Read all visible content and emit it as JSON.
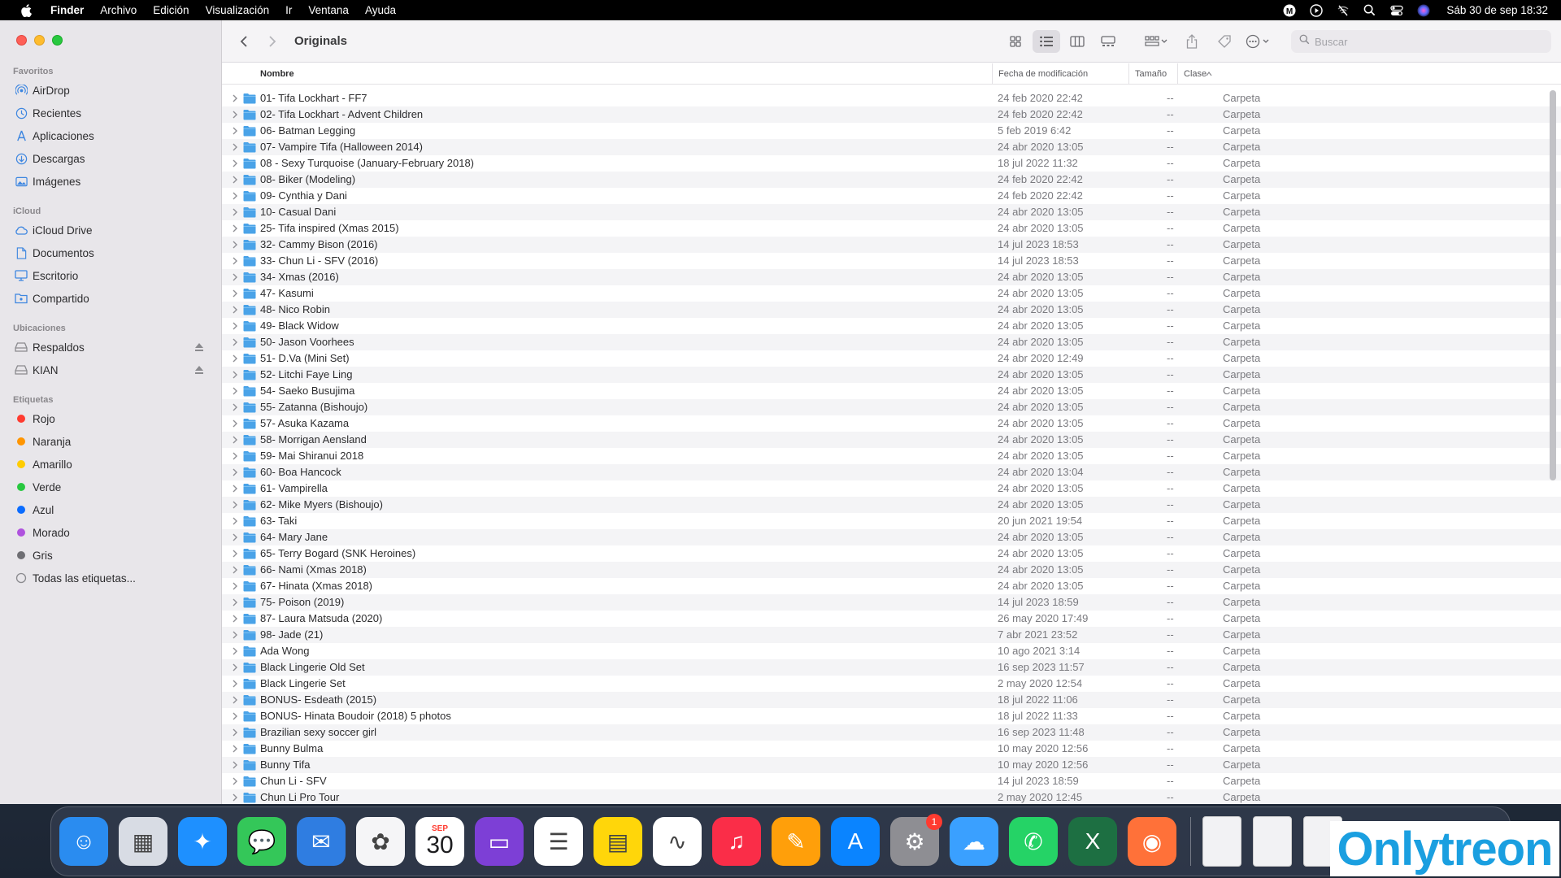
{
  "menubar": {
    "app_name": "Finder",
    "menus": [
      "Archivo",
      "Edición",
      "Visualización",
      "Ir",
      "Ventana",
      "Ayuda"
    ],
    "clock": "Sáb 30 de sep  18:32",
    "status_icons": [
      "m-icon",
      "play-icon",
      "wifi-off-icon",
      "search-icon",
      "control-center-icon",
      "siri-icon"
    ]
  },
  "window": {
    "title": "Originals",
    "search_placeholder": "Buscar"
  },
  "sidebar": {
    "sections": [
      {
        "title": "Favoritos",
        "items": [
          {
            "label": "AirDrop",
            "icon": "airdrop-icon"
          },
          {
            "label": "Recientes",
            "icon": "clock-icon"
          },
          {
            "label": "Aplicaciones",
            "icon": "apps-icon"
          },
          {
            "label": "Descargas",
            "icon": "download-icon"
          },
          {
            "label": "Imágenes",
            "icon": "photo-icon"
          }
        ]
      },
      {
        "title": "iCloud",
        "items": [
          {
            "label": "iCloud Drive",
            "icon": "cloud-icon"
          },
          {
            "label": "Documentos",
            "icon": "document-icon"
          },
          {
            "label": "Escritorio",
            "icon": "desktop-icon"
          },
          {
            "label": "Compartido",
            "icon": "shared-folder-icon"
          }
        ]
      },
      {
        "title": "Ubicaciones",
        "items": [
          {
            "label": "Respaldos",
            "icon": "drive-icon",
            "eject": true
          },
          {
            "label": "KIAN",
            "icon": "drive-icon",
            "eject": true
          }
        ]
      },
      {
        "title": "Etiquetas",
        "items": [
          {
            "label": "Rojo",
            "tag_color": "#ff3b30"
          },
          {
            "label": "Naranja",
            "tag_color": "#ff9500"
          },
          {
            "label": "Amarillo",
            "tag_color": "#ffcc00"
          },
          {
            "label": "Verde",
            "tag_color": "#28c840"
          },
          {
            "label": "Azul",
            "tag_color": "#0a6cff"
          },
          {
            "label": "Morado",
            "tag_color": "#af52de"
          },
          {
            "label": "Gris",
            "tag_color": "#6e6e73"
          },
          {
            "label": "Todas las etiquetas...",
            "icon": "tags-icon"
          }
        ]
      }
    ]
  },
  "columns": {
    "name": "Nombre",
    "date": "Fecha de modificación",
    "size": "Tamaño",
    "kind": "Clase"
  },
  "files": [
    {
      "name": "01- Tifa Lockhart - FF7",
      "date": "24 feb 2020 22:42",
      "size": "--",
      "kind": "Carpeta"
    },
    {
      "name": "02- Tifa Lockhart - Advent Children",
      "date": "24 feb 2020 22:42",
      "size": "--",
      "kind": "Carpeta"
    },
    {
      "name": "06- Batman Legging",
      "date": "5 feb 2019 6:42",
      "size": "--",
      "kind": "Carpeta"
    },
    {
      "name": "07- Vampire Tifa (Halloween 2014)",
      "date": "24 abr 2020 13:05",
      "size": "--",
      "kind": "Carpeta"
    },
    {
      "name": "08 - Sexy Turquoise (January-February 2018)",
      "date": "18 jul 2022 11:32",
      "size": "--",
      "kind": "Carpeta"
    },
    {
      "name": "08- Biker (Modeling)",
      "date": "24 feb 2020 22:42",
      "size": "--",
      "kind": "Carpeta"
    },
    {
      "name": "09- Cynthia y Dani",
      "date": "24 feb 2020 22:42",
      "size": "--",
      "kind": "Carpeta"
    },
    {
      "name": "10- Casual Dani",
      "date": "24 abr 2020 13:05",
      "size": "--",
      "kind": "Carpeta"
    },
    {
      "name": "25- Tifa inspired (Xmas 2015)",
      "date": "24 abr 2020 13:05",
      "size": "--",
      "kind": "Carpeta"
    },
    {
      "name": "32- Cammy Bison (2016)",
      "date": "14 jul 2023 18:53",
      "size": "--",
      "kind": "Carpeta"
    },
    {
      "name": "33- Chun Li - SFV (2016)",
      "date": "14 jul 2023 18:53",
      "size": "--",
      "kind": "Carpeta"
    },
    {
      "name": "34- Xmas (2016)",
      "date": "24 abr 2020 13:05",
      "size": "--",
      "kind": "Carpeta"
    },
    {
      "name": "47- Kasumi",
      "date": "24 abr 2020 13:05",
      "size": "--",
      "kind": "Carpeta"
    },
    {
      "name": "48- Nico Robin",
      "date": "24 abr 2020 13:05",
      "size": "--",
      "kind": "Carpeta"
    },
    {
      "name": "49- Black Widow",
      "date": "24 abr 2020 13:05",
      "size": "--",
      "kind": "Carpeta"
    },
    {
      "name": "50- Jason Voorhees",
      "date": "24 abr 2020 13:05",
      "size": "--",
      "kind": "Carpeta"
    },
    {
      "name": "51- D.Va (Mini Set)",
      "date": "24 abr 2020 12:49",
      "size": "--",
      "kind": "Carpeta"
    },
    {
      "name": "52- Litchi Faye Ling",
      "date": "24 abr 2020 13:05",
      "size": "--",
      "kind": "Carpeta"
    },
    {
      "name": "54- Saeko Busujima",
      "date": "24 abr 2020 13:05",
      "size": "--",
      "kind": "Carpeta"
    },
    {
      "name": "55- Zatanna (Bishoujo)",
      "date": "24 abr 2020 13:05",
      "size": "--",
      "kind": "Carpeta"
    },
    {
      "name": "57- Asuka Kazama",
      "date": "24 abr 2020 13:05",
      "size": "--",
      "kind": "Carpeta"
    },
    {
      "name": "58- Morrigan Aensland",
      "date": "24 abr 2020 13:05",
      "size": "--",
      "kind": "Carpeta"
    },
    {
      "name": "59- Mai Shiranui 2018",
      "date": "24 abr 2020 13:05",
      "size": "--",
      "kind": "Carpeta"
    },
    {
      "name": "60- Boa Hancock",
      "date": "24 abr 2020 13:04",
      "size": "--",
      "kind": "Carpeta"
    },
    {
      "name": "61- Vampirella",
      "date": "24 abr 2020 13:05",
      "size": "--",
      "kind": "Carpeta"
    },
    {
      "name": "62- Mike Myers (Bishoujo)",
      "date": "24 abr 2020 13:05",
      "size": "--",
      "kind": "Carpeta"
    },
    {
      "name": "63- Taki",
      "date": "20 jun 2021 19:54",
      "size": "--",
      "kind": "Carpeta"
    },
    {
      "name": "64- Mary Jane",
      "date": "24 abr 2020 13:05",
      "size": "--",
      "kind": "Carpeta"
    },
    {
      "name": "65- Terry Bogard (SNK Heroines)",
      "date": "24 abr 2020 13:05",
      "size": "--",
      "kind": "Carpeta"
    },
    {
      "name": "66- Nami (Xmas 2018)",
      "date": "24 abr 2020 13:05",
      "size": "--",
      "kind": "Carpeta"
    },
    {
      "name": "67- Hinata (Xmas 2018)",
      "date": "24 abr 2020 13:05",
      "size": "--",
      "kind": "Carpeta"
    },
    {
      "name": "75- Poison (2019)",
      "date": "14 jul 2023 18:59",
      "size": "--",
      "kind": "Carpeta"
    },
    {
      "name": "87- Laura Matsuda (2020)",
      "date": "26 may 2020 17:49",
      "size": "--",
      "kind": "Carpeta"
    },
    {
      "name": "98- Jade (21)",
      "date": "7 abr 2021 23:52",
      "size": "--",
      "kind": "Carpeta"
    },
    {
      "name": "Ada Wong",
      "date": "10 ago 2021 3:14",
      "size": "--",
      "kind": "Carpeta"
    },
    {
      "name": "Black Lingerie Old Set",
      "date": "16 sep 2023 11:57",
      "size": "--",
      "kind": "Carpeta"
    },
    {
      "name": "Black Lingerie Set",
      "date": "2 may 2020 12:54",
      "size": "--",
      "kind": "Carpeta"
    },
    {
      "name": "BONUS- Esdeath (2015)",
      "date": "18 jul 2022 11:06",
      "size": "--",
      "kind": "Carpeta"
    },
    {
      "name": "BONUS- Hinata Boudoir (2018) 5 photos",
      "date": "18 jul 2022 11:33",
      "size": "--",
      "kind": "Carpeta"
    },
    {
      "name": "Brazilian sexy soccer girl",
      "date": "16 sep 2023 11:48",
      "size": "--",
      "kind": "Carpeta"
    },
    {
      "name": "Bunny Bulma",
      "date": "10 may 2020 12:56",
      "size": "--",
      "kind": "Carpeta"
    },
    {
      "name": "Bunny Tifa",
      "date": "10 may 2020 12:56",
      "size": "--",
      "kind": "Carpeta"
    },
    {
      "name": "Chun Li - SFV",
      "date": "14 jul 2023 18:59",
      "size": "--",
      "kind": "Carpeta"
    },
    {
      "name": "Chun Li Pro Tour",
      "date": "2 may 2020 12:45",
      "size": "--",
      "kind": "Carpeta"
    }
  ],
  "dock": {
    "apps": [
      {
        "name": "finder-icon",
        "color": "#2a8cf0",
        "glyph": "☺"
      },
      {
        "name": "launchpad-icon",
        "color": "#d8dce4",
        "glyph": "▦"
      },
      {
        "name": "safari-icon",
        "color": "#1e90ff",
        "glyph": "✦"
      },
      {
        "name": "messages-icon",
        "color": "#34c759",
        "glyph": "💬"
      },
      {
        "name": "mail-icon",
        "color": "#2f7de1",
        "glyph": "✉"
      },
      {
        "name": "photos-icon",
        "color": "#f5f5f7",
        "glyph": "✿"
      },
      {
        "name": "calendar-icon",
        "color": "#ffffff",
        "glyph": "30"
      },
      {
        "name": "podcast-app-icon",
        "color": "#7d3fd6",
        "glyph": "▭"
      },
      {
        "name": "reminders-icon",
        "color": "#ffffff",
        "glyph": "☰"
      },
      {
        "name": "notes-icon",
        "color": "#ffd60a",
        "glyph": "▤"
      },
      {
        "name": "freeform-icon",
        "color": "#ffffff",
        "glyph": "∿"
      },
      {
        "name": "music-icon",
        "color": "#fa2d48",
        "glyph": "♫"
      },
      {
        "name": "pages-icon",
        "color": "#ff9f0a",
        "glyph": "✎"
      },
      {
        "name": "app-store-icon",
        "color": "#0a84ff",
        "glyph": "A"
      },
      {
        "name": "system-settings-icon",
        "color": "#8e8e93",
        "glyph": "⚙",
        "badge": "1"
      },
      {
        "name": "cloud-app-icon",
        "color": "#3aa0ff",
        "glyph": "☁"
      },
      {
        "name": "whatsapp-icon",
        "color": "#25d366",
        "glyph": "✆"
      },
      {
        "name": "excel-icon",
        "color": "#1d6f42",
        "glyph": "X"
      },
      {
        "name": "firefox-icon",
        "color": "#ff7139",
        "glyph": "◉"
      }
    ],
    "calendar_month": "SEP"
  },
  "watermark": "Onlytreon",
  "colors": {
    "folder": "#4aa3e8",
    "accent": "#0a6cff"
  }
}
